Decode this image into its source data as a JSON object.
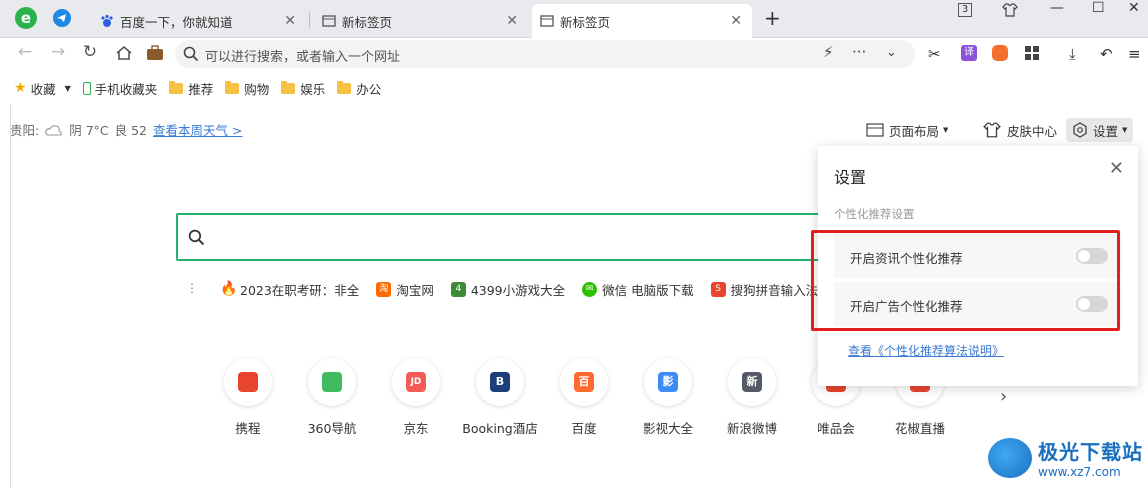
{
  "tabs": [
    {
      "title": "百度一下，你就知道"
    },
    {
      "title": "新标签页"
    },
    {
      "title": "新标签页"
    }
  ],
  "window": {
    "tab_count": "3"
  },
  "address": {
    "placeholder": "可以进行搜索，或者输入一个网址",
    "more": "···"
  },
  "bookmarks": {
    "favorites": "收藏",
    "mobile": "手机收藏夹",
    "folders": [
      "推荐",
      "购物",
      "娱乐",
      "办公"
    ]
  },
  "weather": {
    "city": "贵阳:",
    "condition": "阴 7°C",
    "aqi": "良 52",
    "link": "查看本周天气 >"
  },
  "toolbar": {
    "layout": "页面布局",
    "skin": "皮肤中心",
    "settings": "设置"
  },
  "hotlinks": [
    {
      "label": "2023在职考研：非全",
      "color": "#e8452f"
    },
    {
      "label": "淘宝网",
      "color": "#ff6a00"
    },
    {
      "label": "4399小游戏大全",
      "color": "#3d8b37"
    },
    {
      "label": "微信 电脑版下载",
      "color": "#2dc100"
    },
    {
      "label": "搜狗拼音输入法",
      "color": "#e8452f"
    }
  ],
  "sites": [
    {
      "label": "携程",
      "glyph": "",
      "color": "#e8452f"
    },
    {
      "label": "360导航",
      "glyph": "",
      "color": "#3dbb5e"
    },
    {
      "label": "京东",
      "glyph": "JD",
      "color": "#f25c54"
    },
    {
      "label": "Booking酒店",
      "glyph": "B",
      "color": "#1c3f7c"
    },
    {
      "label": "百度",
      "glyph": "百",
      "color": "#ff6a2e"
    },
    {
      "label": "影视大全",
      "glyph": "影",
      "color": "#3b8cf5"
    },
    {
      "label": "新浪微博",
      "glyph": "新",
      "color": "#555a66"
    },
    {
      "label": "唯品会",
      "glyph": "",
      "color": "#e8452f"
    },
    {
      "label": "花椒直播",
      "glyph": "",
      "color": "#e8452f"
    }
  ],
  "settings_panel": {
    "title": "设置",
    "section": "个性化推荐设置",
    "options": [
      {
        "label": "开启资讯个性化推荐",
        "enabled": false
      },
      {
        "label": "开启广告个性化推荐",
        "enabled": false
      }
    ],
    "link": "查看《个性化推荐算法说明》"
  },
  "watermark": {
    "title": "极光下载站",
    "url": "www.xz7.com"
  },
  "colors": {
    "accent": "#27b06e",
    "link": "#3a7bd5",
    "highlight": "#e02020"
  }
}
